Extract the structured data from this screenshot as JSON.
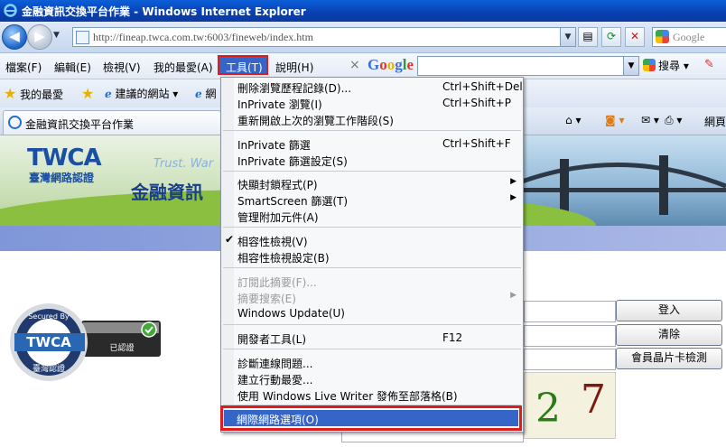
{
  "window": {
    "title": "金融資訊交換平台作業 - Windows Internet Explorer"
  },
  "address": {
    "url": "http://fineap.twca.com.tw:6003/fineweb/index.htm"
  },
  "search_box": {
    "placeholder": "Google"
  },
  "menubar": {
    "items": [
      "檔案(F)",
      "編輯(E)",
      "檢視(V)",
      "我的最愛(A)",
      "工具(T)",
      "說明(H)"
    ]
  },
  "google_toolbar": {
    "close": "×",
    "logo": "Google",
    "search_label": "搜尋"
  },
  "favorites_bar": {
    "favorites": "我的最愛",
    "suggested": "建議的網站",
    "more": "網"
  },
  "tab": {
    "title": "金融資訊交換平台作業"
  },
  "command_bar": {
    "page": "網頁"
  },
  "banner": {
    "logo": "TWCA",
    "logo_sub": "臺灣網路認證",
    "trust": "Trust. War",
    "heading": "金融資訊"
  },
  "seal": {
    "top_text": "Secured By",
    "logo": "TWCA",
    "bottom_text": "臺灣認證",
    "verified": "已認證"
  },
  "login": {
    "login_button": "登入",
    "clear_button": "清除",
    "card_check_button": "會員晶片卡檢測",
    "captcha_digits": [
      "2",
      "7"
    ]
  },
  "tools_menu": {
    "groups": [
      [
        {
          "label": "刪除瀏覽歷程記錄(D)...",
          "shortcut": "Ctrl+Shift+Del"
        },
        {
          "label": "InPrivate 瀏覽(I)",
          "shortcut": "Ctrl+Shift+P"
        },
        {
          "label": "重新開啟上次的瀏覽工作階段(S)",
          "shortcut": ""
        }
      ],
      [
        {
          "label": "InPrivate 篩選",
          "shortcut": "Ctrl+Shift+F"
        },
        {
          "label": "InPrivate 篩選設定(S)",
          "shortcut": ""
        }
      ],
      [
        {
          "label": "快顯封鎖程式(P)",
          "shortcut": "",
          "submenu": true
        },
        {
          "label": "SmartScreen 篩選(T)",
          "shortcut": "",
          "submenu": true
        },
        {
          "label": "管理附加元件(A)",
          "shortcut": ""
        }
      ],
      [
        {
          "label": "相容性檢視(V)",
          "shortcut": "",
          "checked": true
        },
        {
          "label": "相容性檢視設定(B)",
          "shortcut": ""
        }
      ],
      [
        {
          "label": "訂閱此摘要(F)...",
          "shortcut": "",
          "disabled": true
        },
        {
          "label": "摘要搜索(E)",
          "shortcut": "",
          "disabled": true,
          "submenu": true
        },
        {
          "label": "Windows Update(U)",
          "shortcut": ""
        }
      ],
      [
        {
          "label": "開發者工具(L)",
          "shortcut": "F12"
        }
      ],
      [
        {
          "label": "診斷連線問題...",
          "shortcut": ""
        },
        {
          "label": "建立行動最愛...",
          "shortcut": ""
        },
        {
          "label": "使用 Windows Live Writer 發佈至部落格(B)",
          "shortcut": ""
        }
      ]
    ],
    "highlighted": "網際網路選項(O)"
  }
}
